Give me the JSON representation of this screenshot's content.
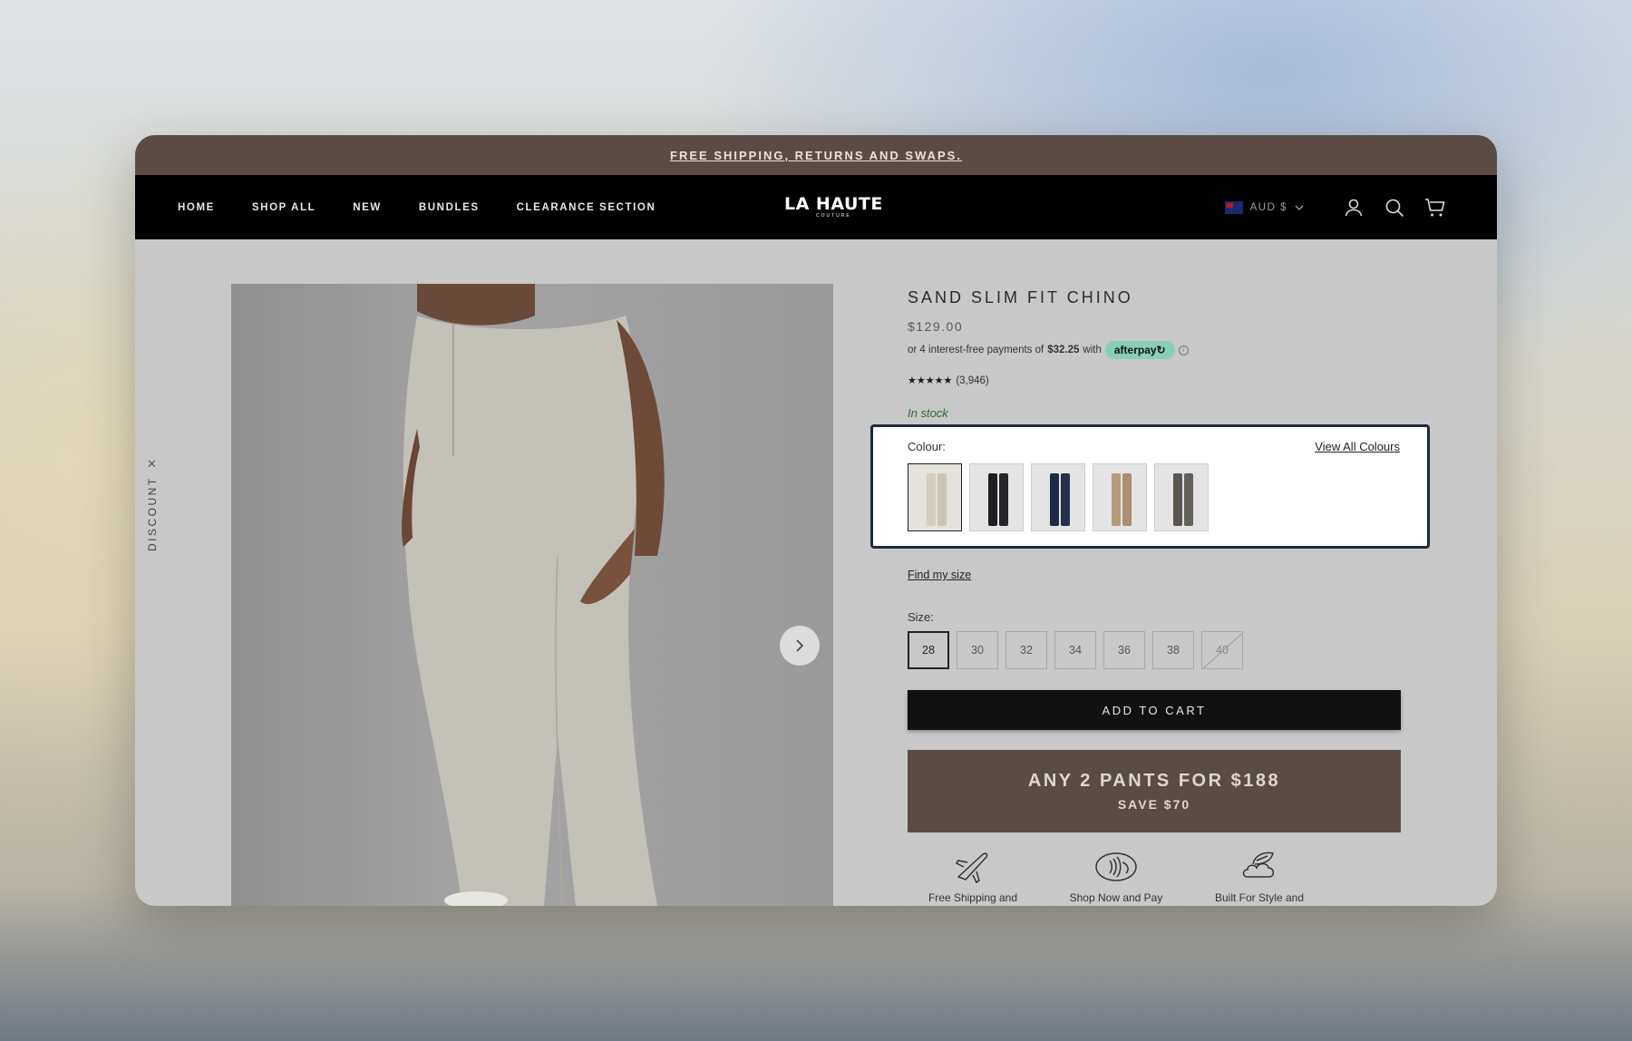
{
  "announcement": "FREE SHIPPING, RETURNS AND SWAPS.",
  "nav": {
    "links": [
      "HOME",
      "SHOP ALL",
      "NEW",
      "BUNDLES",
      "CLEARANCE SECTION"
    ],
    "logo_line1": "LA HAUTE",
    "logo_line2": "COUTURE",
    "currency": "AUD $"
  },
  "discount_tab": "DISCOUNT",
  "product": {
    "title": "SAND SLIM FIT CHINO",
    "price": "$129.00",
    "afterpay_prefix": "or 4 interest-free payments of",
    "afterpay_amount": "$32.25",
    "afterpay_with": "with",
    "afterpay_badge": "afterpay",
    "rating_stars": 5,
    "rating_count": "(3,946)",
    "stock": "In stock",
    "colour_label": "Colour:",
    "view_all_colours": "View All Colours",
    "colours": [
      {
        "name": "Sand",
        "hex": "#d9d4c6"
      },
      {
        "name": "Black",
        "hex": "#1e1e22"
      },
      {
        "name": "Navy",
        "hex": "#1f2a44"
      },
      {
        "name": "Tan",
        "hex": "#b39b7c"
      },
      {
        "name": "Olive",
        "hex": "#5a5650"
      }
    ],
    "find_my_size": "Find my size",
    "size_label": "Size:",
    "sizes": [
      "28",
      "30",
      "32",
      "34",
      "36",
      "38",
      "40"
    ],
    "selected_size": "28",
    "unavailable_size": "40",
    "add_to_cart": "ADD TO CART",
    "promo_line1": "ANY 2 PANTS FOR $188",
    "promo_line2": "SAVE $70",
    "features": [
      "Free Shipping and",
      "Shop Now and Pay",
      "Built For Style and"
    ]
  },
  "colors": {
    "announcement_bg": "#5b4b45",
    "nav_bg": "#000000",
    "stock_green": "#2e6b2e",
    "afterpay_mint": "#88cfb4"
  }
}
